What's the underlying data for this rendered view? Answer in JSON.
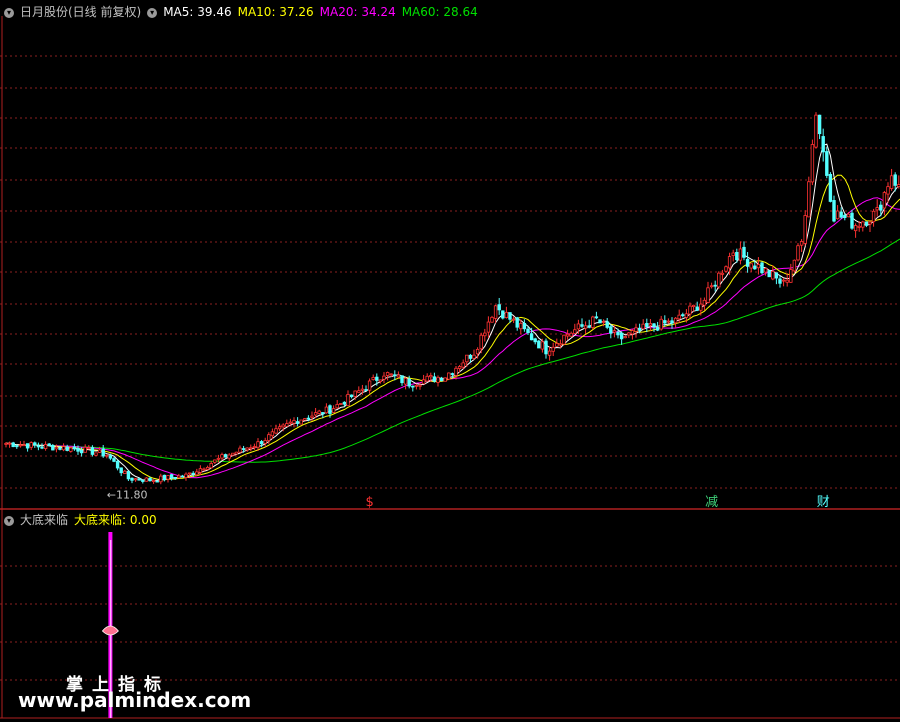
{
  "header_main": {
    "title": "日月股份(日线 前复权)",
    "ma5_label": "MA5: 39.46",
    "ma10_label": "MA10: 37.26",
    "ma20_label": "MA20: 34.24",
    "ma60_label": "MA60: 28.64"
  },
  "header_sub": {
    "indicator_name": "大底来临",
    "indicator_value_label": "大底来临: 0.00"
  },
  "colors": {
    "up": "#ff3232",
    "down": "#54ffff",
    "ma5": "#ffffff",
    "ma10": "#ffff00",
    "ma20": "#ff00ff",
    "ma60": "#00e000",
    "grid": "#8a1f1f",
    "text": "#c0c0c0"
  },
  "markers": [
    {
      "text": "$",
      "color": "#ff3232",
      "bar": 101
    },
    {
      "text": "减",
      "color": "#3fd27a",
      "bar": 196
    },
    {
      "text": "财",
      "color": "#54ffff",
      "bar": 227
    }
  ],
  "low_annotation": "←11.80",
  "watermark": {
    "line1": "掌上指标",
    "line2": "www.palmindex.com"
  },
  "chart_data": [
    {
      "type": "candlestick",
      "title": "日月股份(日线 前复权)",
      "price_range": [
        10.0,
        45.0
      ],
      "bar_count": 250,
      "close_anchors": [
        [
          0,
          14.6
        ],
        [
          10,
          14.4
        ],
        [
          20,
          14.2
        ],
        [
          28,
          13.8
        ],
        [
          34,
          12.1
        ],
        [
          40,
          12.0
        ],
        [
          50,
          12.3
        ],
        [
          60,
          13.6
        ],
        [
          70,
          14.6
        ],
        [
          80,
          16.2
        ],
        [
          90,
          17.0
        ],
        [
          97,
          18.1
        ],
        [
          105,
          19.6
        ],
        [
          112,
          18.9
        ],
        [
          122,
          19.4
        ],
        [
          130,
          21.1
        ],
        [
          136,
          24.4
        ],
        [
          142,
          23.0
        ],
        [
          150,
          21.3
        ],
        [
          156,
          22.4
        ],
        [
          164,
          23.4
        ],
        [
          170,
          22.0
        ],
        [
          178,
          22.8
        ],
        [
          186,
          23.3
        ],
        [
          194,
          24.8
        ],
        [
          202,
          28.3
        ],
        [
          210,
          27.0
        ],
        [
          216,
          25.9
        ],
        [
          221,
          28.9
        ],
        [
          225,
          38.2
        ],
        [
          230,
          31.0
        ],
        [
          236,
          30.2
        ],
        [
          242,
          31.0
        ],
        [
          246,
          33.8
        ],
        [
          249,
          32.2
        ]
      ],
      "low_label": 11.8,
      "moving_averages": [
        {
          "name": "MA5",
          "last": 39.46
        },
        {
          "name": "MA10",
          "last": 37.26
        },
        {
          "name": "MA20",
          "last": 34.24
        },
        {
          "name": "MA60",
          "last": 28.64
        }
      ]
    },
    {
      "type": "bar",
      "title": "大底来临",
      "series": [
        {
          "name": "大底来临",
          "last": 0.0
        }
      ],
      "signals": [
        {
          "bar": 29
        }
      ]
    }
  ]
}
